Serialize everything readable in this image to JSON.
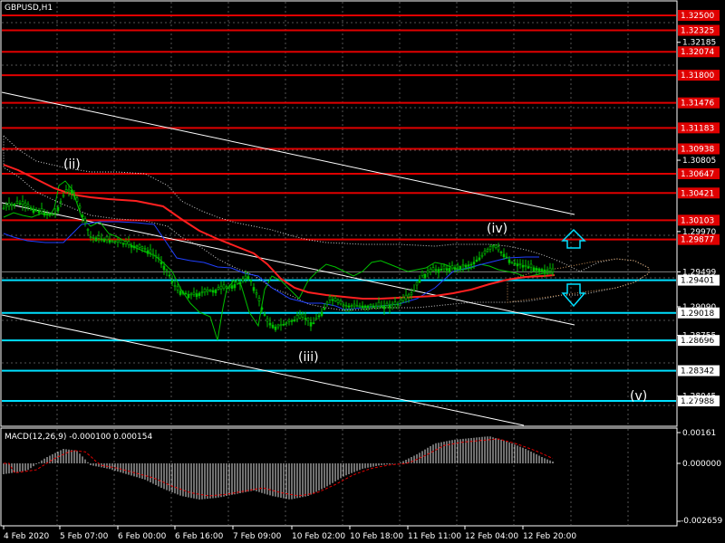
{
  "window": {
    "title": "GBPUSD,H1"
  },
  "macd": {
    "label": "MACD(12,26,9) -0.000100 0.000154",
    "scale": [
      "0.00161",
      "0.000000",
      "-0.002659"
    ]
  },
  "colors": {
    "resistance": "#e00000",
    "support": "#00e0ff",
    "price": "#00c000",
    "ma": "#ff2020",
    "blue_ma": "#2040ff",
    "cloud": "#ffffff",
    "cloud_future": "#e0a060",
    "macd_hist": "#e0e0e0",
    "macd_signal": "#e00000"
  },
  "price_axis": {
    "plain": [
      "1.32185",
      "1.30805",
      "1.29970",
      "1.29499",
      "1.29090",
      "1.28755",
      "1.28045"
    ],
    "resistance_tags": [
      "1.32500",
      "1.32325",
      "1.32074",
      "1.31800",
      "1.31476",
      "1.31183",
      "1.30938",
      "1.30647",
      "1.30421",
      "1.30103",
      "1.29877"
    ],
    "support_tags": [
      "1.29401",
      "1.29018",
      "1.28696",
      "1.28342",
      "1.27988"
    ]
  },
  "time_axis": [
    "4 Feb 2020",
    "5 Feb 07:00",
    "6 Feb 00:00",
    "6 Feb 16:00",
    "7 Feb 09:00",
    "10 Feb 02:00",
    "10 Feb 18:00",
    "11 Feb 11:00",
    "12 Feb 04:00",
    "12 Feb 20:00"
  ],
  "wave_labels": [
    "(ii)",
    "(iii)",
    "(iv)",
    "(v)"
  ],
  "icons": [
    "arrow-up-icon",
    "arrow-down-icon"
  ]
}
